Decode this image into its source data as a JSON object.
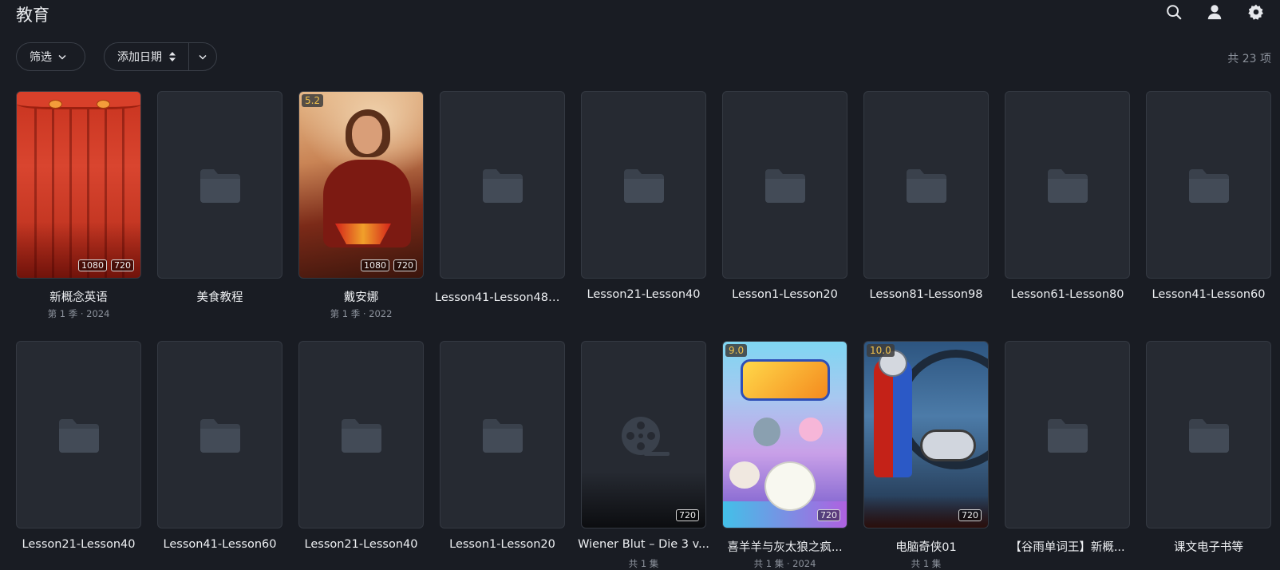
{
  "header": {
    "title": "教育",
    "icons": [
      "search-icon",
      "user-icon",
      "settings-icon"
    ]
  },
  "toolbar": {
    "filter_label": "筛选",
    "sort_label": "添加日期",
    "count_text": "共 23 项"
  },
  "items": [
    {
      "title": "新概念英语",
      "subtitle": "第 1 季 · 2024",
      "badges": [
        "1080",
        "720"
      ],
      "rating": "",
      "art": "curtain"
    },
    {
      "title": "美食教程",
      "subtitle": "",
      "badges": [],
      "rating": "",
      "art": "folder"
    },
    {
      "title": "戴安娜",
      "subtitle": "第 1 季 · 2022",
      "badges": [
        "1080",
        "720"
      ],
      "rating": "5.2",
      "art": "dana"
    },
    {
      "title": "Lesson41-Lesson48（...",
      "subtitle": "",
      "badges": [],
      "rating": "",
      "art": "folder"
    },
    {
      "title": "Lesson21-Lesson40",
      "subtitle": "",
      "badges": [],
      "rating": "",
      "art": "folder"
    },
    {
      "title": "Lesson1-Lesson20",
      "subtitle": "",
      "badges": [],
      "rating": "",
      "art": "folder"
    },
    {
      "title": "Lesson81-Lesson98",
      "subtitle": "",
      "badges": [],
      "rating": "",
      "art": "folder"
    },
    {
      "title": "Lesson61-Lesson80",
      "subtitle": "",
      "badges": [],
      "rating": "",
      "art": "folder"
    },
    {
      "title": "Lesson41-Lesson60",
      "subtitle": "",
      "badges": [],
      "rating": "",
      "art": "folder"
    },
    {
      "title": "Lesson21-Lesson40",
      "subtitle": "",
      "badges": [],
      "rating": "",
      "art": "folder"
    },
    {
      "title": "Lesson41-Lesson60",
      "subtitle": "",
      "badges": [],
      "rating": "",
      "art": "folder"
    },
    {
      "title": "Lesson21-Lesson40",
      "subtitle": "",
      "badges": [],
      "rating": "",
      "art": "folder"
    },
    {
      "title": "Lesson1-Lesson20",
      "subtitle": "",
      "badges": [],
      "rating": "",
      "art": "folder"
    },
    {
      "title": "Wiener Blut – Die 3 v...",
      "subtitle": "共 1 集",
      "badges": [
        "720"
      ],
      "rating": "",
      "art": "reel"
    },
    {
      "title": "喜羊羊与灰太狼之疯...",
      "subtitle": "共 1 集 · 2024",
      "badges": [
        "720"
      ],
      "rating": "9.0",
      "art": "yang"
    },
    {
      "title": "电脑奇侠01",
      "subtitle": "共 1 集",
      "badges": [
        "720"
      ],
      "rating": "10.0",
      "art": "kika"
    },
    {
      "title": "【谷雨单词王】新概...",
      "subtitle": "",
      "badges": [],
      "rating": "",
      "art": "folder"
    },
    {
      "title": "课文电子书等",
      "subtitle": "",
      "badges": [],
      "rating": "",
      "art": "folder"
    }
  ]
}
